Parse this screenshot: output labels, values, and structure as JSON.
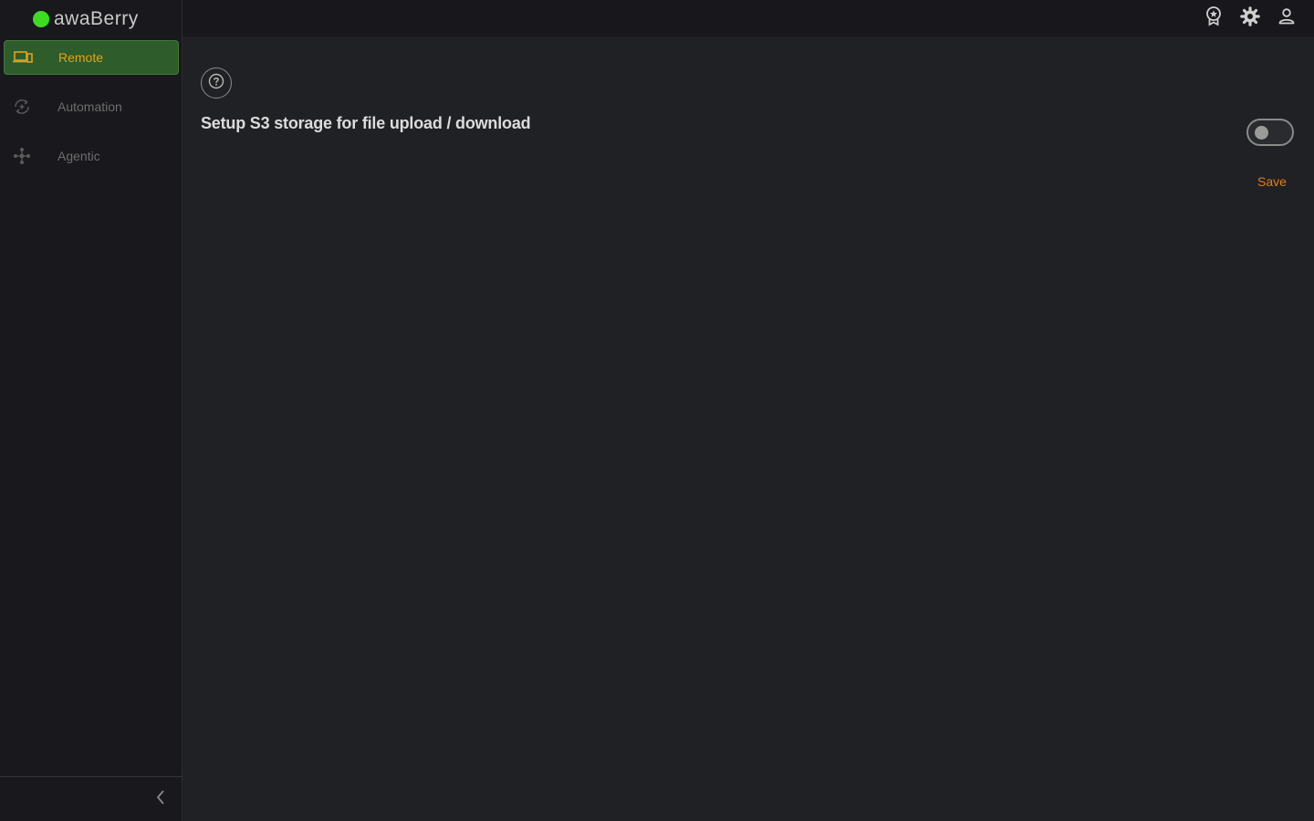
{
  "app": {
    "name": "awaBerry",
    "brand_color": "#3ddc20",
    "accent_color": "#e3a21a"
  },
  "sidebar": {
    "items": [
      {
        "label": "Remote",
        "icon": "devices-icon",
        "active": true
      },
      {
        "label": "Automation",
        "icon": "automation-icon",
        "active": false
      },
      {
        "label": "Agentic",
        "icon": "agentic-icon",
        "active": false
      }
    ],
    "collapse_icon": "chevron-left-icon"
  },
  "topbar": {
    "icons": [
      "award-icon",
      "gear-icon",
      "user-icon"
    ]
  },
  "main": {
    "help_icon": "help-circle-icon",
    "title": "Setup S3 storage for file upload / download",
    "toggle_enabled": false,
    "save_label": "Save"
  }
}
